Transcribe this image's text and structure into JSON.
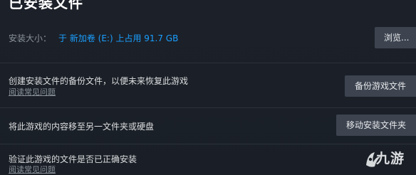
{
  "header": {
    "title": "已安装文件"
  },
  "install_size": {
    "label": "安装大小：",
    "value": "于 新加卷 (E:) 上占用 91.7 GB",
    "browse_label": "浏览..."
  },
  "rows": [
    {
      "text": "创建安装文件的备份文件，以便未来恢复此游戏",
      "link": "阅读常见问题",
      "button": "备份游戏文件"
    },
    {
      "text": "将此游戏的内容移至另一文件夹或硬盘",
      "button": "移动安装文件夹"
    },
    {
      "text": "验证此游戏的文件是否已正确安装",
      "link": "阅读常见问题"
    }
  ],
  "watermark": {
    "text": "九游"
  },
  "colors": {
    "background": "#1a1f26",
    "accent": "#1a9fff",
    "button_bg": "#3d4450",
    "muted_text": "#8b929a"
  }
}
